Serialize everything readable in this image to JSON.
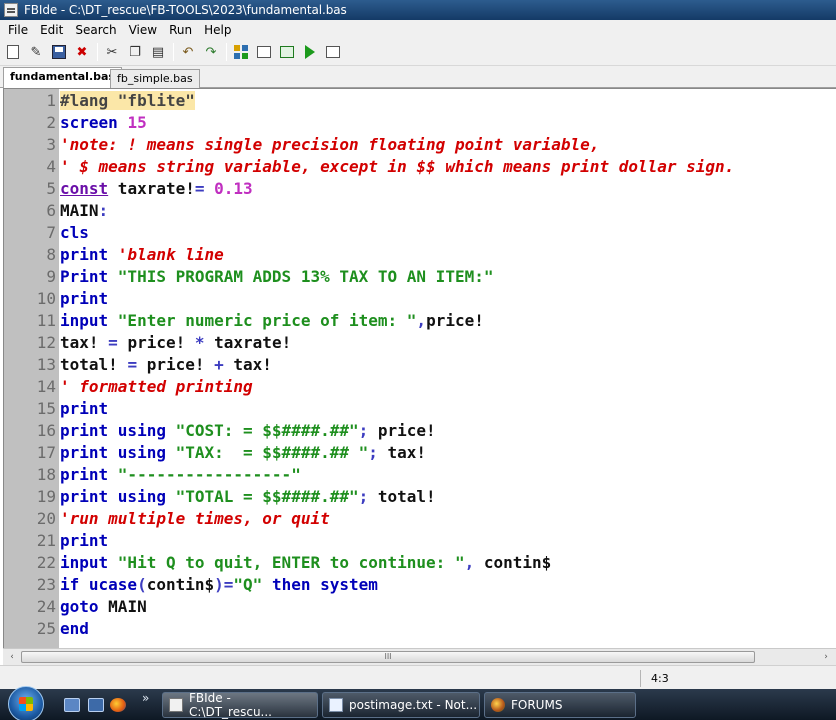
{
  "window": {
    "title": "FBIde - C:\\DT_rescue\\FB-TOOLS\\2023\\fundamental.bas"
  },
  "menu": [
    "File",
    "Edit",
    "Search",
    "View",
    "Run",
    "Help"
  ],
  "toolbar": {
    "icons": [
      "new-file-icon",
      "open-file-icon",
      "save-icon",
      "close-file-icon",
      "cut-icon",
      "copy-icon",
      "paste-icon",
      "undo-icon",
      "redo-icon",
      "compile-icon",
      "window-icon",
      "run-icon",
      "play-icon",
      "output-icon"
    ]
  },
  "tabs": [
    {
      "label": "fundamental.bas",
      "active": true
    },
    {
      "label": "fb_simple.bas",
      "active": false
    }
  ],
  "editor": {
    "lines": [
      {
        "n": "1",
        "tokens": [
          {
            "t": "#lang \"fblite\"",
            "c": "c-dir"
          }
        ]
      },
      {
        "n": "2",
        "tokens": [
          {
            "t": "screen ",
            "c": "c-kw"
          },
          {
            "t": "15",
            "c": "c-num"
          }
        ]
      },
      {
        "n": "3",
        "tokens": [
          {
            "t": "'note: ! means single precision floating point variable,",
            "c": "c-cmt"
          }
        ]
      },
      {
        "n": "4",
        "tokens": [
          {
            "t": "' $ means string variable, except in $$ which means print dollar sign.",
            "c": "c-cmt"
          }
        ]
      },
      {
        "n": "5",
        "tokens": [
          {
            "t": "const",
            "c": "c-kw-u"
          },
          {
            "t": " taxrate!",
            "c": "c-plain"
          },
          {
            "t": "= ",
            "c": "c-op"
          },
          {
            "t": "0.13",
            "c": "c-num"
          }
        ]
      },
      {
        "n": "6",
        "tokens": [
          {
            "t": "MAIN",
            "c": "c-plain"
          },
          {
            "t": ":",
            "c": "c-op"
          }
        ]
      },
      {
        "n": "7",
        "tokens": [
          {
            "t": "cls",
            "c": "c-kw"
          }
        ]
      },
      {
        "n": "8",
        "tokens": [
          {
            "t": "print ",
            "c": "c-kw"
          },
          {
            "t": "'blank line",
            "c": "c-cmt"
          }
        ]
      },
      {
        "n": "9",
        "tokens": [
          {
            "t": "Print ",
            "c": "c-kw"
          },
          {
            "t": "\"THIS PROGRAM ADDS 13% TAX TO AN ITEM:\"",
            "c": "c-str"
          }
        ]
      },
      {
        "n": "10",
        "tokens": [
          {
            "t": "print",
            "c": "c-kw"
          }
        ]
      },
      {
        "n": "11",
        "tokens": [
          {
            "t": "input ",
            "c": "c-kw"
          },
          {
            "t": "\"Enter numeric price of item: \"",
            "c": "c-str"
          },
          {
            "t": ",",
            "c": "c-op"
          },
          {
            "t": "price!",
            "c": "c-plain"
          }
        ]
      },
      {
        "n": "12",
        "tokens": [
          {
            "t": "tax! ",
            "c": "c-plain"
          },
          {
            "t": "= ",
            "c": "c-op"
          },
          {
            "t": "price! ",
            "c": "c-plain"
          },
          {
            "t": "* ",
            "c": "c-op"
          },
          {
            "t": "taxrate!",
            "c": "c-plain"
          }
        ]
      },
      {
        "n": "13",
        "tokens": [
          {
            "t": "total! ",
            "c": "c-plain"
          },
          {
            "t": "= ",
            "c": "c-op"
          },
          {
            "t": "price! ",
            "c": "c-plain"
          },
          {
            "t": "+ ",
            "c": "c-op"
          },
          {
            "t": "tax!",
            "c": "c-plain"
          }
        ]
      },
      {
        "n": "14",
        "tokens": [
          {
            "t": "' formatted printing",
            "c": "c-cmt"
          }
        ]
      },
      {
        "n": "15",
        "tokens": [
          {
            "t": "print",
            "c": "c-kw"
          }
        ]
      },
      {
        "n": "16",
        "tokens": [
          {
            "t": "print using ",
            "c": "c-kw"
          },
          {
            "t": "\"COST: = $$####.##\"",
            "c": "c-str"
          },
          {
            "t": "; ",
            "c": "c-op"
          },
          {
            "t": "price!",
            "c": "c-plain"
          }
        ]
      },
      {
        "n": "17",
        "tokens": [
          {
            "t": "print using ",
            "c": "c-kw"
          },
          {
            "t": "\"TAX:  = $$####.## \"",
            "c": "c-str"
          },
          {
            "t": "; ",
            "c": "c-op"
          },
          {
            "t": "tax!",
            "c": "c-plain"
          }
        ]
      },
      {
        "n": "18",
        "tokens": [
          {
            "t": "print ",
            "c": "c-kw"
          },
          {
            "t": "\"-----------------\"",
            "c": "c-str"
          }
        ]
      },
      {
        "n": "19",
        "tokens": [
          {
            "t": "print using ",
            "c": "c-kw"
          },
          {
            "t": "\"TOTAL = $$####.##\"",
            "c": "c-str"
          },
          {
            "t": "; ",
            "c": "c-op"
          },
          {
            "t": "total!",
            "c": "c-plain"
          }
        ]
      },
      {
        "n": "20",
        "tokens": [
          {
            "t": "'run multiple times, or quit",
            "c": "c-cmt"
          }
        ]
      },
      {
        "n": "21",
        "tokens": [
          {
            "t": "print",
            "c": "c-kw"
          }
        ]
      },
      {
        "n": "22",
        "tokens": [
          {
            "t": "input ",
            "c": "c-kw"
          },
          {
            "t": "\"Hit Q to quit, ENTER to continue: \"",
            "c": "c-str"
          },
          {
            "t": ", ",
            "c": "c-op"
          },
          {
            "t": "contin$",
            "c": "c-plain"
          }
        ]
      },
      {
        "n": "23",
        "tokens": [
          {
            "t": "if ucase",
            "c": "c-kw"
          },
          {
            "t": "(",
            "c": "c-op"
          },
          {
            "t": "contin$",
            "c": "c-plain"
          },
          {
            "t": ")=",
            "c": "c-op"
          },
          {
            "t": "\"Q\" ",
            "c": "c-str"
          },
          {
            "t": "then system",
            "c": "c-kw"
          }
        ]
      },
      {
        "n": "24",
        "tokens": [
          {
            "t": "goto ",
            "c": "c-kw"
          },
          {
            "t": "MAIN",
            "c": "c-plain"
          }
        ]
      },
      {
        "n": "25",
        "tokens": [
          {
            "t": "end",
            "c": "c-kw"
          }
        ]
      }
    ]
  },
  "scrollbar": {
    "left_arrow": "‹",
    "right_arrow": "›",
    "grip": "III"
  },
  "status": {
    "position": "4:3"
  },
  "taskbar": {
    "more": "»",
    "tasks": [
      {
        "label": "FBIde - C:\\DT_rescu...",
        "icon": "fbide-icon",
        "active": true
      },
      {
        "label": "postimage.txt - Not...",
        "icon": "notepad-icon",
        "active": false
      },
      {
        "label": "FORUMS",
        "icon": "forums-icon",
        "active": false
      }
    ]
  }
}
